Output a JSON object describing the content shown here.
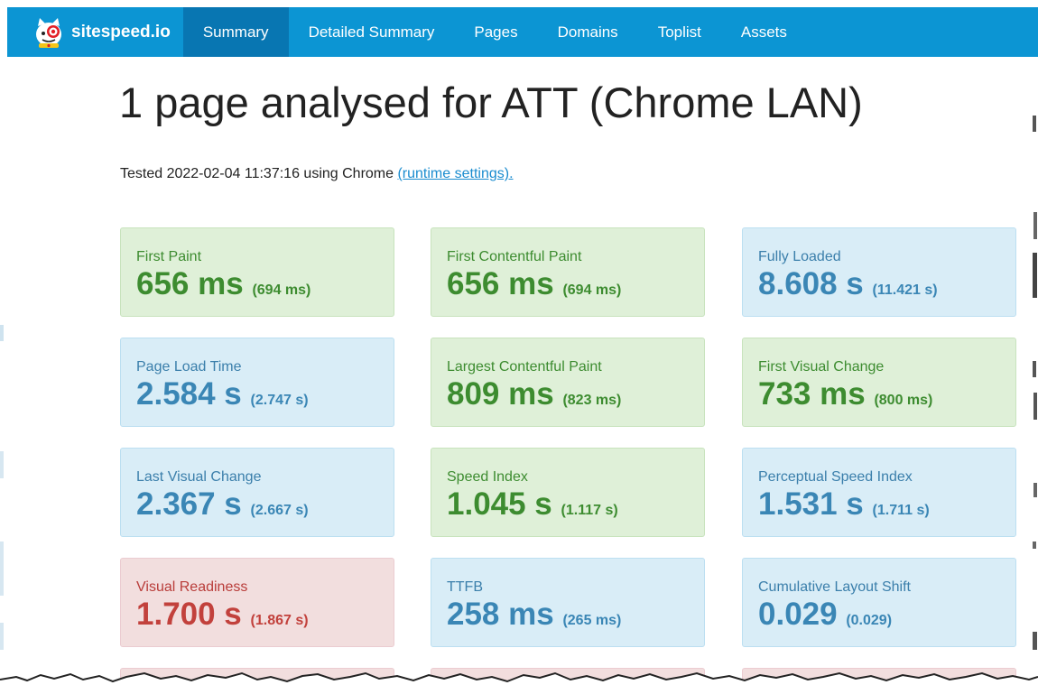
{
  "brand": {
    "name": "sitespeed.io"
  },
  "nav": {
    "items": [
      {
        "label": "Summary",
        "active": true
      },
      {
        "label": "Detailed Summary",
        "active": false
      },
      {
        "label": "Pages",
        "active": false
      },
      {
        "label": "Domains",
        "active": false
      },
      {
        "label": "Toplist",
        "active": false
      },
      {
        "label": "Assets",
        "active": false
      }
    ]
  },
  "header": {
    "title": "1 page analysed for ATT (Chrome LAN)",
    "tested_prefix": "Tested 2022-02-04 11:37:16 using Chrome ",
    "settings_link": "(runtime settings)."
  },
  "colors": {
    "nav_bg": "#0c95d3",
    "nav_active": "#0876b2",
    "ok": "#dff0d8",
    "info": "#d9edf7",
    "error": "#f2dede"
  },
  "metrics": [
    {
      "label": "First Paint",
      "value": "656 ms",
      "sub": "(694 ms)",
      "status": "green"
    },
    {
      "label": "First Contentful Paint",
      "value": "656 ms",
      "sub": "(694 ms)",
      "status": "green"
    },
    {
      "label": "Fully Loaded",
      "value": "8.608 s",
      "sub": "(11.421 s)",
      "status": "blue"
    },
    {
      "label": "Page Load Time",
      "value": "2.584 s",
      "sub": "(2.747 s)",
      "status": "blue"
    },
    {
      "label": "Largest Contentful Paint",
      "value": "809 ms",
      "sub": "(823 ms)",
      "status": "green"
    },
    {
      "label": "First Visual Change",
      "value": "733 ms",
      "sub": "(800 ms)",
      "status": "green"
    },
    {
      "label": "Last Visual Change",
      "value": "2.367 s",
      "sub": "(2.667 s)",
      "status": "blue"
    },
    {
      "label": "Speed Index",
      "value": "1.045 s",
      "sub": "(1.117 s)",
      "status": "green"
    },
    {
      "label": "Perceptual Speed Index",
      "value": "1.531 s",
      "sub": "(1.711 s)",
      "status": "blue"
    },
    {
      "label": "Visual Readiness",
      "value": "1.700 s",
      "sub": "(1.867 s)",
      "status": "red"
    },
    {
      "label": "TTFB",
      "value": "258 ms",
      "sub": "(265 ms)",
      "status": "blue"
    },
    {
      "label": "Cumulative Layout Shift",
      "value": "0.029",
      "sub": "(0.029)",
      "status": "blue"
    }
  ],
  "partial_cards": [
    {
      "status": "red"
    },
    {
      "status": "red"
    },
    {
      "status": "red"
    }
  ]
}
